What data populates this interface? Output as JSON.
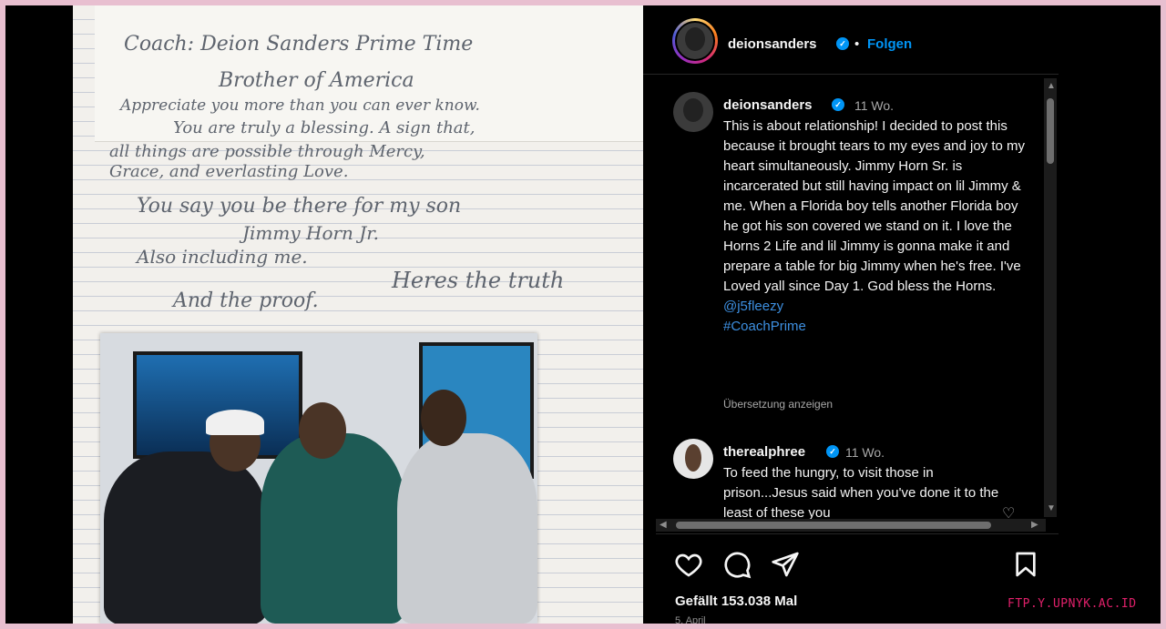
{
  "photo": {
    "note_lines": [
      "Coach: Deion Sanders Prime Time",
      "Brother of America",
      "Appreciate you more than you can ever know.",
      "You are truly a blessing. A sign that,",
      "all things are possible through Mercy,",
      "Grace, and everlasting Love.",
      "You say you be there for my son",
      "Jimmy Horn Jr.",
      "Also including me.",
      "Heres the truth",
      "And the proof."
    ]
  },
  "post": {
    "username": "deionsanders",
    "separator": "•",
    "follow_label": "Folgen",
    "caption": {
      "username": "deionsanders",
      "time": "11 Wo.",
      "text": "This is about relationship! I decided to post this because it brought tears to my eyes and joy to my heart simultaneously. Jimmy Horn Sr. is incarcerated but still having impact on lil Jimmy & me. When a Florida boy tells another Florida boy he got his son covered we stand on it. I love the Horns 2 Life and lil Jimmy is gonna make it and prepare a table for big Jimmy when he's free. I've Loved yall since Day 1. God bless the Horns. ",
      "mention": "@j5fleezy",
      "hashtag": "#CoachPrime",
      "translate": "Übersetzung anzeigen"
    },
    "comment": {
      "username": "therealphree",
      "time": "11 Wo.",
      "text": "To feed the hungry, to visit those in prison...Jesus said when you've done it to the least of these you"
    },
    "likes": "Gefällt 153.038 Mal",
    "date": "5. April",
    "icons": {
      "like": "heart-icon",
      "comment": "comment-icon",
      "share": "share-icon",
      "save": "bookmark-icon"
    },
    "colors": {
      "link": "#3d8fe0",
      "verified": "#0095f6",
      "background": "#000000"
    }
  },
  "watermark": "FTP.Y.UPNYK.AC.ID"
}
